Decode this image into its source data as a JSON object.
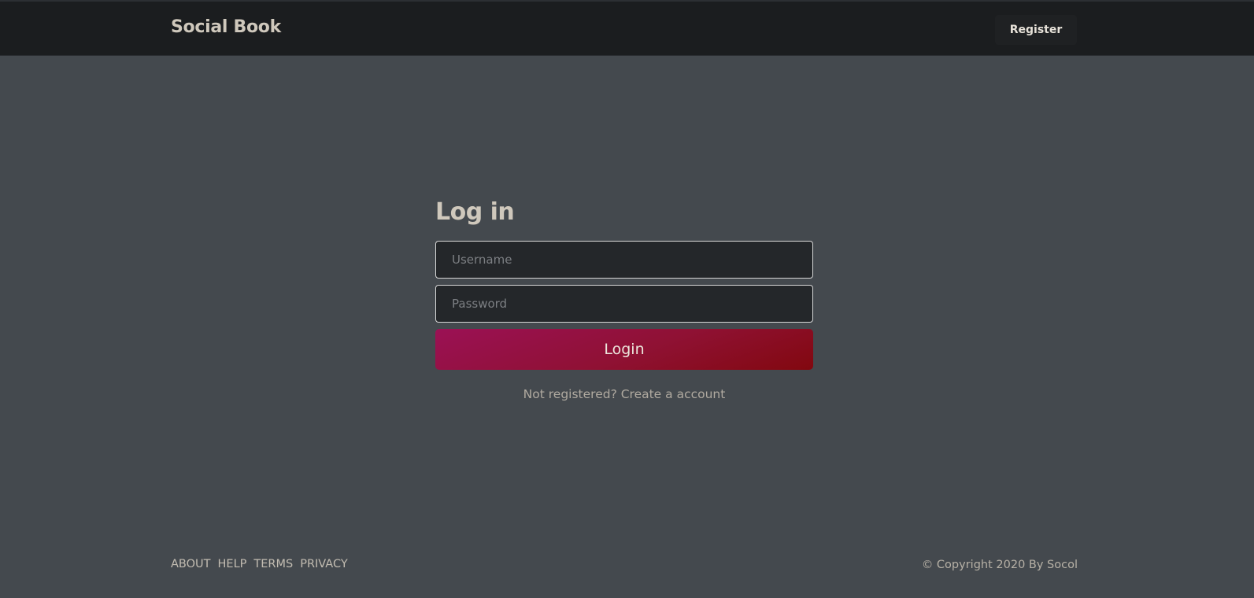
{
  "header": {
    "brand": "Social Book",
    "register_label": "Register"
  },
  "login": {
    "title": "Log in",
    "username_placeholder": "Username",
    "password_placeholder": "Password",
    "submit_label": "Login",
    "register_link": "Not registered? Create a account"
  },
  "footer": {
    "links": [
      "ABOUT",
      "HELP",
      "TERMS",
      "PRIVACY"
    ],
    "copyright": "© Copyright 2020 By Socol"
  },
  "colors": {
    "background": "#44494e",
    "navbar": "#1b1d1f",
    "button_gradient_start": "#9b1155",
    "button_gradient_end": "#82080f"
  }
}
